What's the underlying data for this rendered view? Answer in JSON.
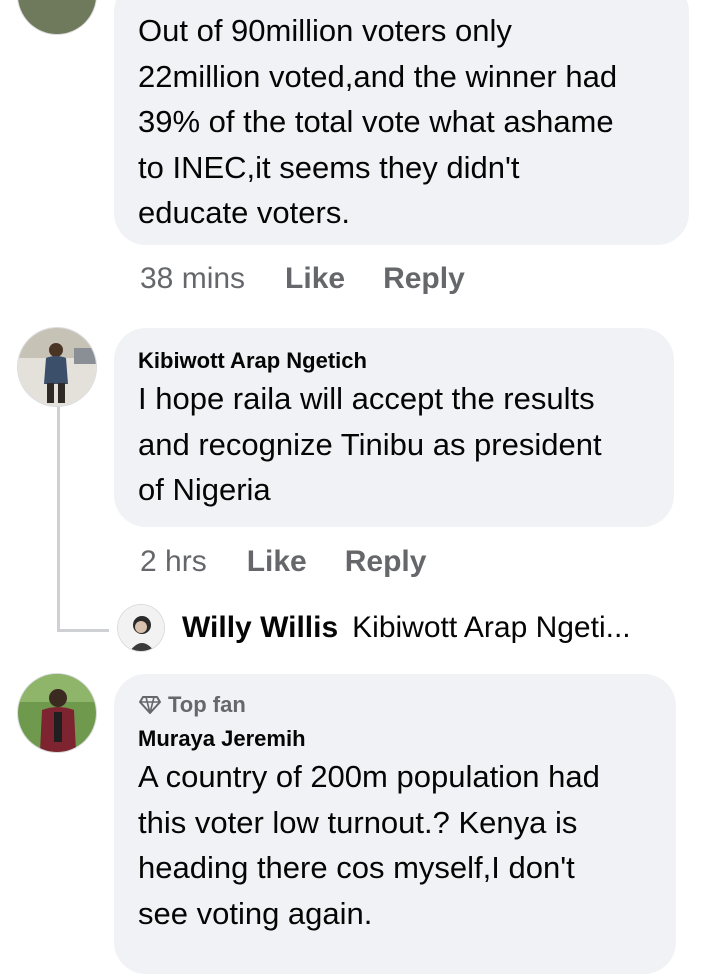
{
  "comments": [
    {
      "author": "",
      "text": "Out of 90million voters only 22million voted,and the winner had 39% of the total vote what ashame to INEC,it seems they didn't educate voters.",
      "lines": [
        "Out of 90million voters only",
        "22million voted,and the winner had",
        "39% of the total vote what ashame",
        "to INEC,it seems they didn't",
        "educate voters."
      ],
      "time": "38 mins",
      "like_label": "Like",
      "reply_label": "Reply"
    },
    {
      "author": "Kibiwott Arap Ngetich",
      "lines": [
        "I hope raila will accept the results",
        "and recognize Tinibu as president",
        "of Nigeria"
      ],
      "time": "2 hrs",
      "like_label": "Like",
      "reply_label": "Reply",
      "reply_preview": {
        "author": "Willy Willis",
        "text": "Kibiwott Arap Ngeti..."
      }
    },
    {
      "badge": "Top fan",
      "author": "Muraya Jeremih",
      "lines": [
        "A country of 200m population had",
        "this voter low turnout.? Kenya is",
        "heading there cos myself,I don't",
        "see voting again."
      ]
    }
  ],
  "colors": {
    "bubble": "#f0f2f5",
    "secondary_text": "#65676b",
    "thread_line": "#ced0d4"
  }
}
